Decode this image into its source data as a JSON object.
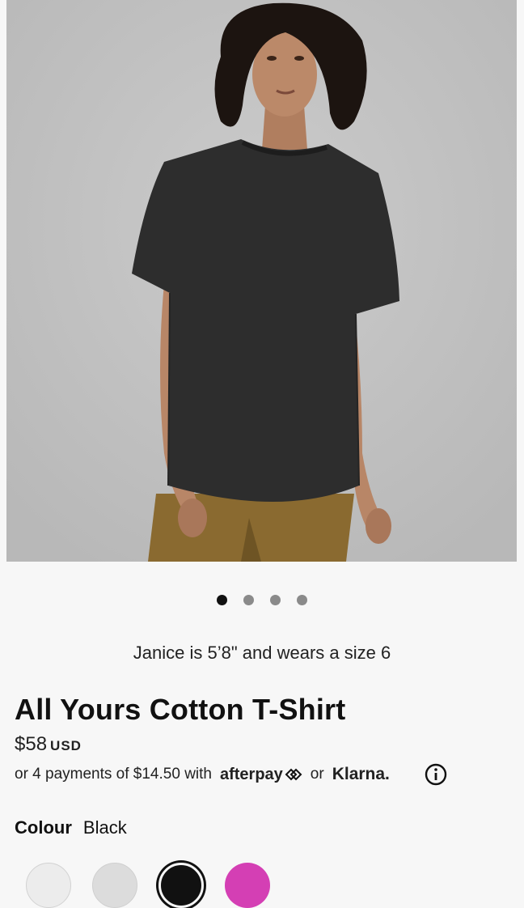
{
  "gallery": {
    "slide_count": 4,
    "active_index": 0
  },
  "model_note": "Janice is 5’8\" and wears a size 6",
  "product": {
    "title": "All Yours Cotton T-Shirt",
    "price": "$58",
    "currency": "USD"
  },
  "payments": {
    "prefix": "or 4 payments of $14.50 with",
    "afterpay": "afterpay",
    "or": "or",
    "klarna": "Klarna."
  },
  "colour": {
    "label": "Colour",
    "selected": "Black"
  },
  "swatches": [
    {
      "name": "White",
      "color": "#ececec"
    },
    {
      "name": "Grey",
      "color": "#dcdcdc"
    },
    {
      "name": "Black",
      "color": "#111111"
    },
    {
      "name": "Pink",
      "color": "#d43fb4"
    }
  ],
  "colors": {
    "background": "#f7f7f7",
    "hero_bg": "#c3c3c3",
    "dot_active": "#111111",
    "dot_inactive": "#8a8a8a"
  }
}
